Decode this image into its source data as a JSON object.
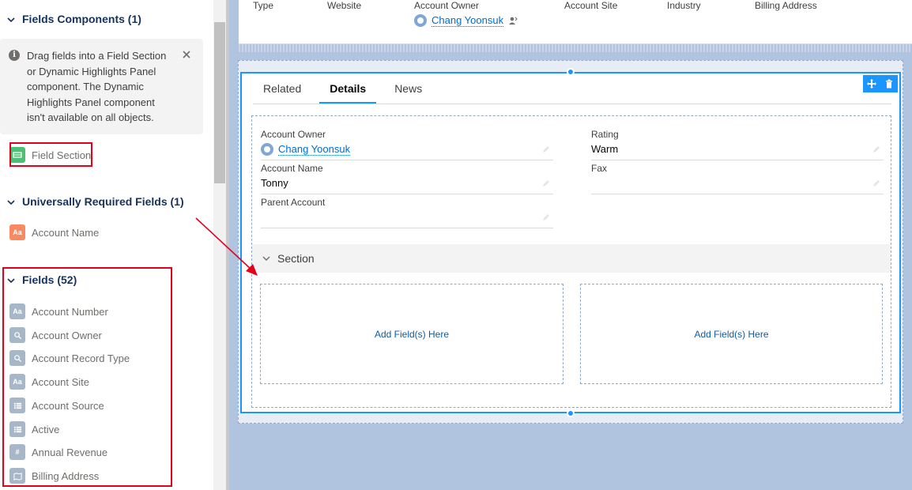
{
  "sidebar": {
    "fields_components": {
      "title": "Fields Components (1)",
      "info": "Drag fields into a Field Section or Dynamic Highlights Panel component. The Dynamic Highlights Panel component isn't available on all objects.",
      "items": [
        "Field Section"
      ]
    },
    "universally_required": {
      "title": "Universally Required Fields (1)",
      "items": [
        "Account Name"
      ]
    },
    "fields": {
      "title": "Fields (52)",
      "items": [
        {
          "label": "Account Number",
          "icon": "text-icon"
        },
        {
          "label": "Account Owner",
          "icon": "lookup-icon"
        },
        {
          "label": "Account Record Type",
          "icon": "lookup-icon"
        },
        {
          "label": "Account Site",
          "icon": "text-icon"
        },
        {
          "label": "Account Source",
          "icon": "picklist-icon"
        },
        {
          "label": "Active",
          "icon": "picklist-icon"
        },
        {
          "label": "Annual Revenue",
          "icon": "currency-icon"
        },
        {
          "label": "Billing Address",
          "icon": "address-icon"
        }
      ]
    }
  },
  "highlights": {
    "labels": [
      "Type",
      "Website",
      "Account Owner",
      "Account Site",
      "Industry",
      "Billing Address"
    ],
    "owner_value": "Chang Yoonsuk"
  },
  "tabs": [
    "Related",
    "Details",
    "News"
  ],
  "details": {
    "left": [
      {
        "label": "Account Owner",
        "value": "Chang Yoonsuk"
      },
      {
        "label": "Account Name",
        "value": "Tonny"
      },
      {
        "label": "Parent Account",
        "value": ""
      }
    ],
    "right": [
      {
        "label": "Rating",
        "value": "Warm"
      },
      {
        "label": "Fax",
        "value": ""
      }
    ],
    "section_title": "Section",
    "drop_zone_label": "Add Field(s) Here"
  },
  "colors": {
    "annotation_red": "#e3001b",
    "selection_blue": "#1b96ff",
    "canvas_bg": "#b0c4df"
  }
}
